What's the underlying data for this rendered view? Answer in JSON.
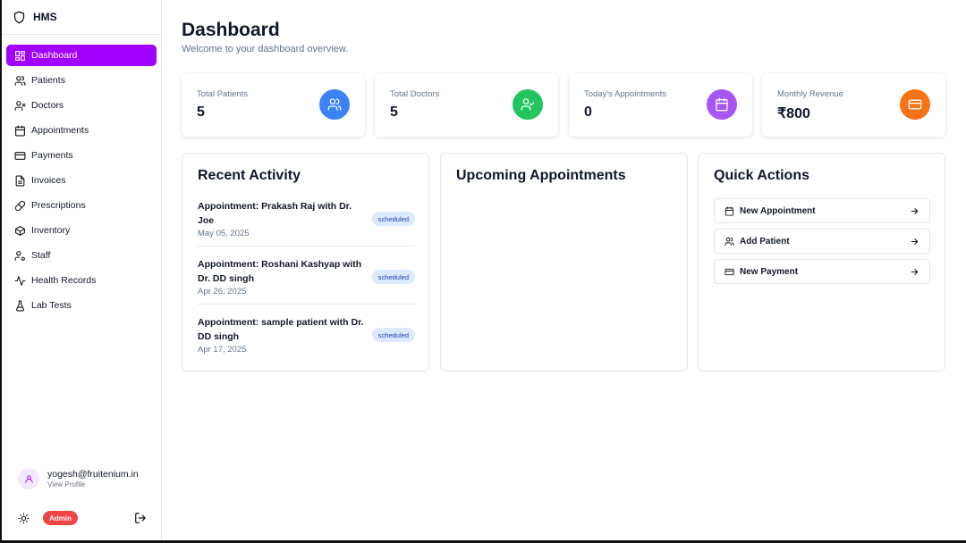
{
  "brand": {
    "name": "HMS",
    "icon": "shield-icon"
  },
  "sidebar": {
    "items": [
      {
        "label": "Dashboard",
        "icon": "layout-grid-icon",
        "active": true
      },
      {
        "label": "Patients",
        "icon": "users-icon"
      },
      {
        "label": "Doctors",
        "icon": "user-x-icon"
      },
      {
        "label": "Appointments",
        "icon": "calendar-icon"
      },
      {
        "label": "Payments",
        "icon": "credit-card-icon"
      },
      {
        "label": "Invoices",
        "icon": "file-text-icon"
      },
      {
        "label": "Prescriptions",
        "icon": "pill-icon"
      },
      {
        "label": "Inventory",
        "icon": "package-icon"
      },
      {
        "label": "Staff",
        "icon": "user-cog-icon"
      },
      {
        "label": "Health Records",
        "icon": "activity-icon"
      },
      {
        "label": "Lab Tests",
        "icon": "flask-icon"
      }
    ],
    "profile": {
      "email": "yogesh@fruitenium.in",
      "link": "View Profile"
    },
    "role": "Admin"
  },
  "page": {
    "title": "Dashboard",
    "subtitle": "Welcome to your dashboard overview."
  },
  "stats": [
    {
      "label": "Total Patients",
      "value": "5",
      "color": "#3b82f6",
      "icon": "users-icon"
    },
    {
      "label": "Total Doctors",
      "value": "5",
      "color": "#22c55e",
      "icon": "user-check-icon"
    },
    {
      "label": "Today's Appointments",
      "value": "0",
      "color": "#a855f7",
      "icon": "calendar-icon"
    },
    {
      "label": "Monthly Revenue",
      "value": "₹800",
      "color": "#f97316",
      "icon": "credit-card-icon"
    }
  ],
  "recent_activity": {
    "title": "Recent Activity",
    "items": [
      {
        "title": "Appointment: Prakash Raj with Dr. Joe",
        "date": "May 05, 2025",
        "status": "scheduled"
      },
      {
        "title": "Appointment: Roshani Kashyap with Dr. DD singh",
        "date": "Apr 26, 2025",
        "status": "scheduled"
      },
      {
        "title": "Appointment: sample patient with Dr. DD singh",
        "date": "Apr 17, 2025",
        "status": "scheduled"
      }
    ]
  },
  "upcoming": {
    "title": "Upcoming Appointments"
  },
  "quick_actions": {
    "title": "Quick Actions",
    "items": [
      {
        "label": "New Appointment",
        "icon": "calendar-icon"
      },
      {
        "label": "Add Patient",
        "icon": "users-icon"
      },
      {
        "label": "New Payment",
        "icon": "credit-card-icon"
      }
    ]
  },
  "colors": {
    "accent": "#a100ff",
    "badge_bg": "#dbeafe",
    "role_badge": "#ef4444"
  }
}
